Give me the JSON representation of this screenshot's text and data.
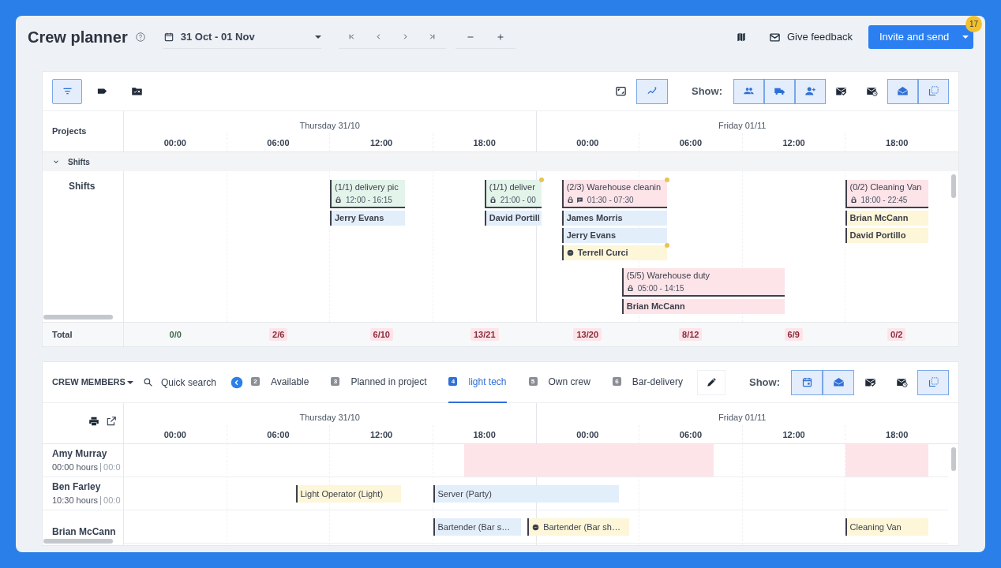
{
  "header": {
    "title": "Crew planner",
    "date_range": "31 Oct - 01 Nov",
    "feedback": "Give feedback",
    "invite": "Invite and send",
    "badge": "17"
  },
  "projects": {
    "left_toggles": [
      {
        "selected": true
      },
      {
        "selected": false
      },
      {
        "selected": false
      }
    ],
    "view_toggles": [
      {
        "selected": false
      },
      {
        "selected": true
      }
    ],
    "show_label": "Show:",
    "show_toggles": [
      {
        "selected": true
      },
      {
        "selected": true
      },
      {
        "selected": true
      },
      {
        "selected": false
      },
      {
        "selected": false
      },
      {
        "selected": true
      },
      {
        "selected": true
      }
    ],
    "row_header": "Projects",
    "days": [
      "Thursday 31/10",
      "Friday 01/11"
    ],
    "hours": [
      "00:00",
      "06:00",
      "12:00",
      "18:00",
      "00:00",
      "06:00",
      "12:00",
      "18:00"
    ],
    "group": {
      "label": "Shifts",
      "expanded": true
    },
    "row_label": "Shifts",
    "shifts": [
      {
        "title": "(1/1) delivery pic",
        "time": "12:00 - 16:15",
        "color": "#e3f4ea",
        "flagged": false,
        "comment": false,
        "assignees": [
          {
            "name": "Jerry Evans",
            "color": "#e3eefb",
            "pending": false,
            "flagged": false
          }
        ]
      },
      {
        "title": "(1/1) deliver",
        "time": "21:00 - 00",
        "color": "#e3f4ea",
        "flagged": true,
        "comment": false,
        "assignees": [
          {
            "name": "David Portill",
            "color": "#e3eefb",
            "pending": false,
            "flagged": false
          }
        ]
      },
      {
        "title": "(2/3) Warehouse cleanin",
        "time": "01:30 - 07:30",
        "color": "#fde4e9",
        "flagged": true,
        "comment": true,
        "assignees": [
          {
            "name": "James Morris",
            "color": "#e3eefb",
            "pending": false,
            "flagged": false
          },
          {
            "name": "Jerry Evans",
            "color": "#e3eefb",
            "pending": false,
            "flagged": false
          },
          {
            "name": "Terrell Curci",
            "color": "#fdf6d8",
            "pending": true,
            "flagged": true
          }
        ]
      },
      {
        "title": "(5/5) Warehouse duty",
        "time": "05:00 - 14:15",
        "color": "#fde4e9",
        "flagged": false,
        "comment": false,
        "assignees": [
          {
            "name": "Brian McCann",
            "color": "#fde4e9",
            "pending": false,
            "flagged": false
          }
        ]
      },
      {
        "title": "(0/2) Cleaning Van",
        "time": "18:00 - 22:45",
        "color": "#fde4e9",
        "flagged": false,
        "comment": false,
        "assignees": [
          {
            "name": "Brian McCann",
            "color": "#fdf6d8",
            "pending": false,
            "flagged": false
          },
          {
            "name": "David Portillo",
            "color": "#fdf6d8",
            "pending": false,
            "flagged": false
          }
        ]
      }
    ],
    "total_label": "Total",
    "totals": [
      {
        "text": "0/0",
        "kind": "met"
      },
      {
        "text": "2/6",
        "kind": "short"
      },
      {
        "text": "6/10",
        "kind": "short"
      },
      {
        "text": "13/21",
        "kind": "short"
      },
      {
        "text": "13/20",
        "kind": "short"
      },
      {
        "text": "8/12",
        "kind": "short"
      },
      {
        "text": "6/9",
        "kind": "short"
      },
      {
        "text": "0/2",
        "kind": "short"
      }
    ]
  },
  "crew": {
    "title": "CREW MEMBERS",
    "search": "Quick search",
    "tabs": [
      {
        "number": "2",
        "label": "Available",
        "selected": false
      },
      {
        "number": "3",
        "label": "Planned in project",
        "selected": false
      },
      {
        "number": "4",
        "label": "light tech",
        "selected": true
      },
      {
        "number": "5",
        "label": "Own crew",
        "selected": false
      },
      {
        "number": "6",
        "label": "Bar-delivery",
        "selected": false
      }
    ],
    "show_label": "Show:",
    "show_toggles": [
      {
        "selected": true
      },
      {
        "selected": true
      },
      {
        "selected": false
      },
      {
        "selected": false
      },
      {
        "selected": true
      }
    ],
    "days": [
      "Thursday 31/10",
      "Friday 01/11"
    ],
    "hours": [
      "00:00",
      "06:00",
      "12:00",
      "18:00",
      "00:00",
      "06:00",
      "12:00",
      "18:00"
    ],
    "members": [
      {
        "name": "Amy Murray",
        "hours": "00:00 hours",
        "hours_2": "00:0",
        "bars": [
          {
            "color": "#fde4e9",
            "pending": false
          },
          {
            "color": "#fde4e9",
            "pending": false
          }
        ]
      },
      {
        "name": "Ben Farley",
        "hours": "10:30 hours",
        "hours_2": "00:0",
        "bars": [
          {
            "label": "Light Operator (Light)",
            "color": "#fdf6d8",
            "pending": false
          },
          {
            "label": "Server (Party)",
            "color": "#e3eefb",
            "pending": false
          }
        ]
      },
      {
        "name": "Brian McCann",
        "bars": [
          {
            "label": "Bartender (Bar s…",
            "color": "#e3eefb",
            "pending": false
          },
          {
            "label": "Bartender (Bar sh…",
            "color": "#fdf6d8",
            "pending": true
          },
          {
            "label": "Cleaning Van",
            "color": "#fdf6d8",
            "pending": false
          }
        ]
      }
    ]
  }
}
